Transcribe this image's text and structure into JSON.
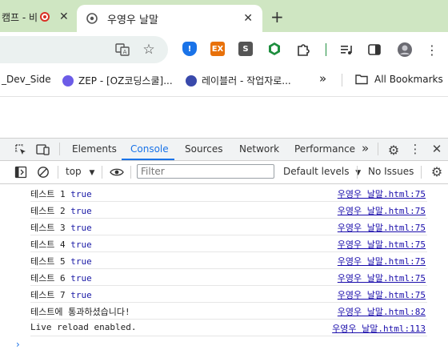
{
  "tabs": [
    {
      "title": "캠프 - 비",
      "recording": true
    },
    {
      "title": "우영우 날말",
      "active": true
    }
  ],
  "new_tab_label": "+",
  "extensions": [
    {
      "name": "shield-icon",
      "color": "#1a73e8",
      "label": "!"
    },
    {
      "name": "ex-icon",
      "color": "#e8710a",
      "label": "EX"
    },
    {
      "name": "s-icon",
      "color": "#555555",
      "label": "S"
    }
  ],
  "bookmarks": {
    "items": [
      "_Dev_Side",
      "ZEP - [OZ코딩스쿨]...",
      "레이블러 - 작업자로..."
    ],
    "overflow": "»",
    "all": "All Bookmarks"
  },
  "devtools": {
    "tabs": [
      "Elements",
      "Console",
      "Sources",
      "Network",
      "Performance"
    ],
    "active_tab": "Console",
    "more_tabs": "»",
    "context": "top",
    "filter_placeholder": "Filter",
    "levels": "Default levels",
    "issues": "No Issues"
  },
  "console_rows": [
    {
      "text": "테스트 1",
      "value": "true",
      "source": "우영우 날말.html:75"
    },
    {
      "text": "테스트 2",
      "value": "true",
      "source": "우영우 날말.html:75"
    },
    {
      "text": "테스트 3",
      "value": "true",
      "source": "우영우 날말.html:75"
    },
    {
      "text": "테스트 4",
      "value": "true",
      "source": "우영우 날말.html:75"
    },
    {
      "text": "테스트 5",
      "value": "true",
      "source": "우영우 날말.html:75"
    },
    {
      "text": "테스트 6",
      "value": "true",
      "source": "우영우 날말.html:75"
    },
    {
      "text": "테스트 7",
      "value": "true",
      "source": "우영우 날말.html:75"
    },
    {
      "text": "테스트에 통과하셨습니다!",
      "value": "",
      "source": "우영우 날말.html:82"
    },
    {
      "text": "Live reload enabled.",
      "value": "",
      "source": "우영우 날말.html:113"
    }
  ],
  "prompt": "›",
  "colors": {
    "tabstrip": "#cfe6c2",
    "accent": "#1a73e8",
    "link": "#1a0dab",
    "value": "#1a1aa6"
  }
}
